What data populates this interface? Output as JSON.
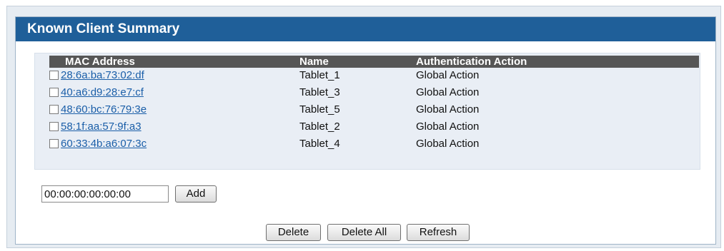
{
  "panel": {
    "title": "Known Client Summary"
  },
  "table": {
    "headers": {
      "mac": "MAC Address",
      "name": "Name",
      "auth": "Authentication Action"
    },
    "rows": [
      {
        "mac": "28:6a:ba:73:02:df",
        "name": "Tablet_1",
        "auth": "Global Action",
        "checked": false
      },
      {
        "mac": "40:a6:d9:28:e7:cf",
        "name": "Tablet_3",
        "auth": "Global Action",
        "checked": false
      },
      {
        "mac": "48:60:bc:76:79:3e",
        "name": "Tablet_5",
        "auth": "Global Action",
        "checked": false
      },
      {
        "mac": "58:1f:aa:57:9f:a3",
        "name": "Tablet_2",
        "auth": "Global Action",
        "checked": false
      },
      {
        "mac": "60:33:4b:a6:07:3c",
        "name": "Tablet_4",
        "auth": "Global Action",
        "checked": false
      }
    ]
  },
  "add_form": {
    "mac_value": "00:00:00:00:00:00",
    "add_label": "Add"
  },
  "actions": {
    "delete_label": "Delete",
    "delete_all_label": "Delete All",
    "refresh_label": "Refresh"
  },
  "colors": {
    "title_bar": "#1f5f99",
    "header_row": "#565656",
    "link": "#1a5ea8",
    "table_bg": "#e9eef5"
  },
  "icons": {
    "row_select": "checkbox"
  }
}
